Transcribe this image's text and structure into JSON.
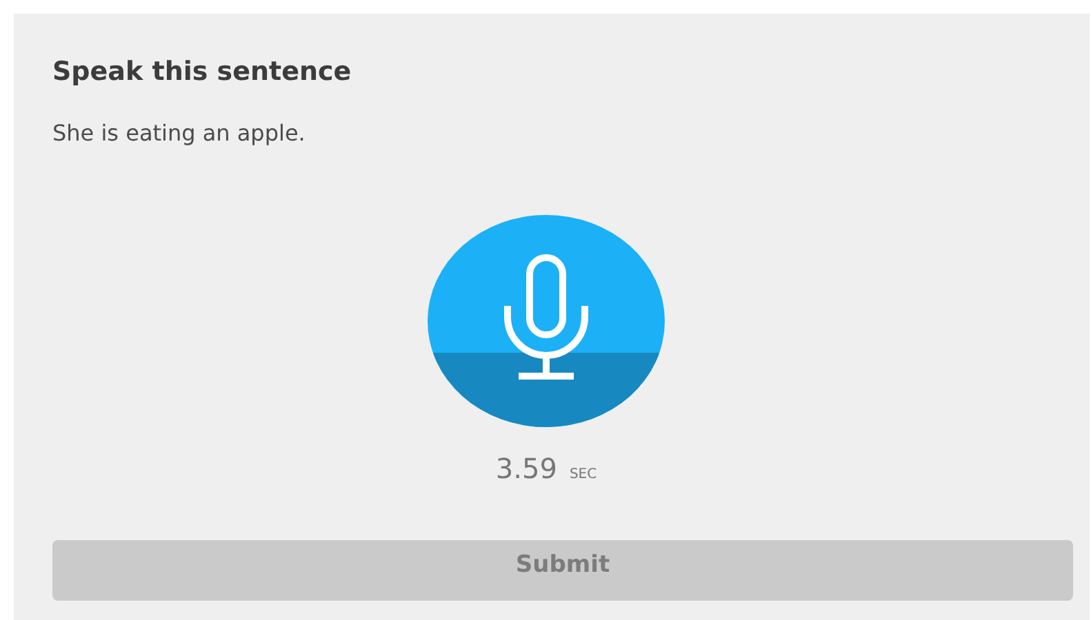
{
  "title": "Speak this sentence",
  "sentence": "She is eating an apple.",
  "recorder": {
    "time": "3.59",
    "unit": "SEC"
  },
  "submit": {
    "label": "Submit",
    "disabled": true
  }
}
